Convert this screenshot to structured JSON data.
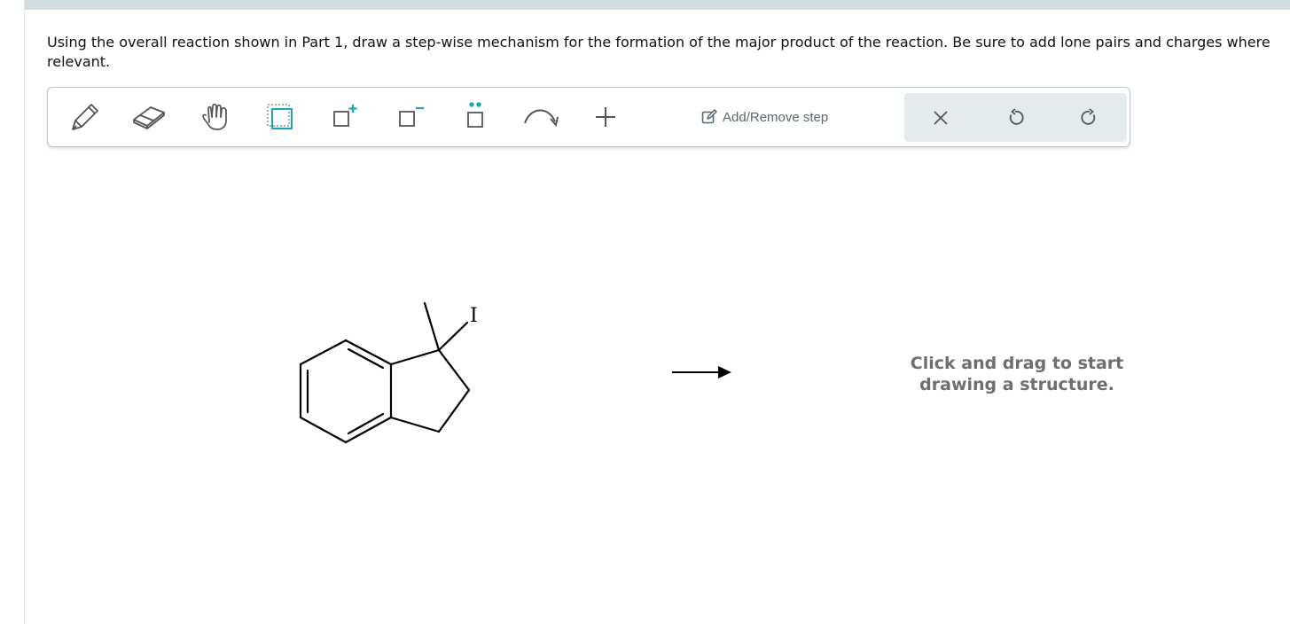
{
  "question": {
    "text": "Using the overall reaction shown in Part 1, draw a step-wise mechanism for the formation of the major product of the reaction. Be sure to add lone pairs and charges where relevant."
  },
  "toolbar": {
    "tools": [
      {
        "name": "pencil-icon"
      },
      {
        "name": "eraser-icon"
      },
      {
        "name": "hand-icon"
      },
      {
        "name": "select-box-icon"
      },
      {
        "name": "add-positive-charge-icon"
      },
      {
        "name": "add-negative-charge-icon"
      },
      {
        "name": "lone-pair-icon"
      },
      {
        "name": "curved-arrow-icon"
      },
      {
        "name": "plus-icon"
      }
    ],
    "step_label": "Add/Remove step",
    "actions": [
      {
        "name": "clear-icon"
      },
      {
        "name": "undo-icon"
      },
      {
        "name": "redo-icon"
      }
    ],
    "accent_color": "#19a6b8"
  },
  "canvas": {
    "atom_label": "I",
    "hint": "Click and drag to start drawing a structure."
  }
}
